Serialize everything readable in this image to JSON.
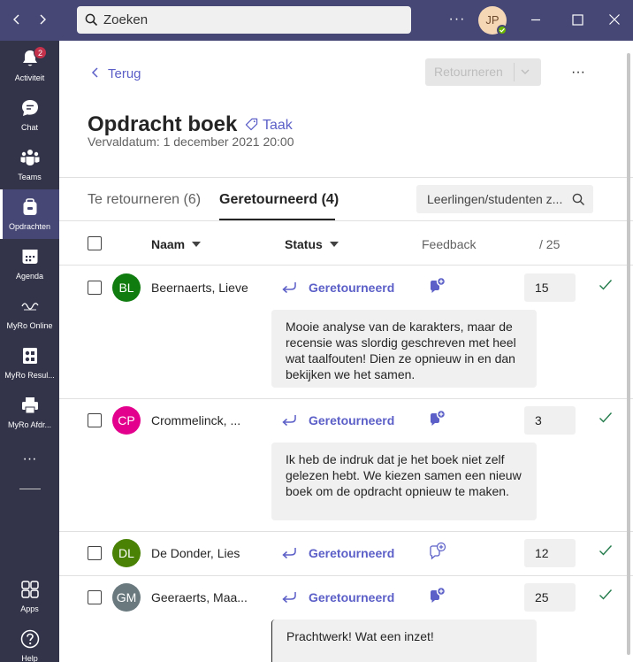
{
  "titlebar": {
    "search_placeholder": "Zoeken",
    "more": "···",
    "user_initials": "JP"
  },
  "rail": {
    "items": [
      {
        "label": "Activiteit",
        "icon": "bell-icon",
        "badge": "2"
      },
      {
        "label": "Chat",
        "icon": "chat-icon"
      },
      {
        "label": "Teams",
        "icon": "teams-icon"
      },
      {
        "label": "Opdrachten",
        "icon": "assignments-icon"
      },
      {
        "label": "Agenda",
        "icon": "calendar-icon"
      },
      {
        "label": "MyRo Online",
        "icon": "myro-online-icon"
      },
      {
        "label": "MyRo Resul...",
        "icon": "myro-results-icon"
      },
      {
        "label": "MyRo Afdr...",
        "icon": "printer-icon"
      },
      {
        "label": "Apps",
        "icon": "apps-icon"
      },
      {
        "label": "Help",
        "icon": "help-icon"
      }
    ],
    "more": "···"
  },
  "header": {
    "back_label": "Terug",
    "return_label": "Retourneren",
    "more": "···",
    "title": "Opdracht boek",
    "tag_label": "Taak",
    "due": "Vervaldatum: 1 december 2021 20:00"
  },
  "tabs": [
    {
      "label": "Te retourneren (6)"
    },
    {
      "label": "Geretourneerd (4)"
    }
  ],
  "filter": {
    "placeholder": "Leerlingen/studenten z..."
  },
  "table": {
    "col_name": "Naam",
    "col_status": "Status",
    "col_feedback": "Feedback",
    "col_points": "/ 25",
    "rows": [
      {
        "initials": "BL",
        "name": "Beernaerts, Lieve",
        "status": "Geretourneerd",
        "grade": "15",
        "avatar_color": "#107c10",
        "feedback": "Mooie analyse van de karakters, maar de recensie was slordig geschreven met heel wat taalfouten! Dien ze opnieuw in en dan bekijken we het samen."
      },
      {
        "initials": "CP",
        "name": "Crommelinck, ...",
        "status": "Geretourneerd",
        "grade": "3",
        "avatar_color": "#e3008c",
        "feedback": "Ik heb de indruk dat je het boek niet zelf gelezen hebt. We kiezen samen een nieuw boek om de opdracht opnieuw  te maken."
      },
      {
        "initials": "DL",
        "name": "De Donder, Lies",
        "status": "Geretourneerd",
        "grade": "12",
        "avatar_color": "#498205",
        "feedback": ""
      },
      {
        "initials": "GM",
        "name": "Geeraerts, Maa...",
        "status": "Geretourneerd",
        "grade": "25",
        "avatar_color": "#69797e",
        "feedback": "Prachtwerk! Wat een inzet!"
      }
    ]
  },
  "colors": {
    "titlebar": "#464775",
    "rail": "#33344a",
    "accent": "#5b5fc7",
    "check": "#237b4b"
  }
}
